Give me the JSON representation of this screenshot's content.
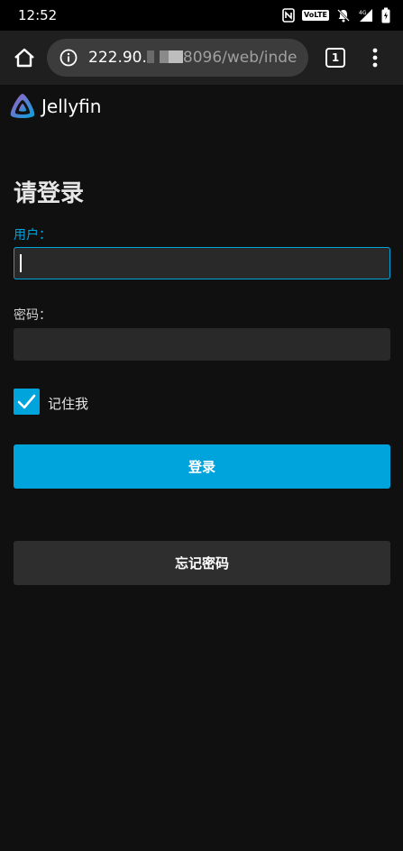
{
  "status_bar": {
    "time": "12:52",
    "volte_label": "VoLTE",
    "network_label": "4G"
  },
  "browser": {
    "url_prefix": "222.90.",
    "url_suffix": "8096/web/inde",
    "tab_count": "1"
  },
  "app": {
    "logo_text": "Jellyfin",
    "accent_color": "#00a4dc"
  },
  "login": {
    "title": "请登录",
    "username_label": "用户：",
    "username_value": "",
    "password_label": "密码：",
    "password_value": "",
    "remember_label": "记住我",
    "remember_checked": true,
    "login_button": "登录",
    "forgot_button": "忘记密码"
  }
}
